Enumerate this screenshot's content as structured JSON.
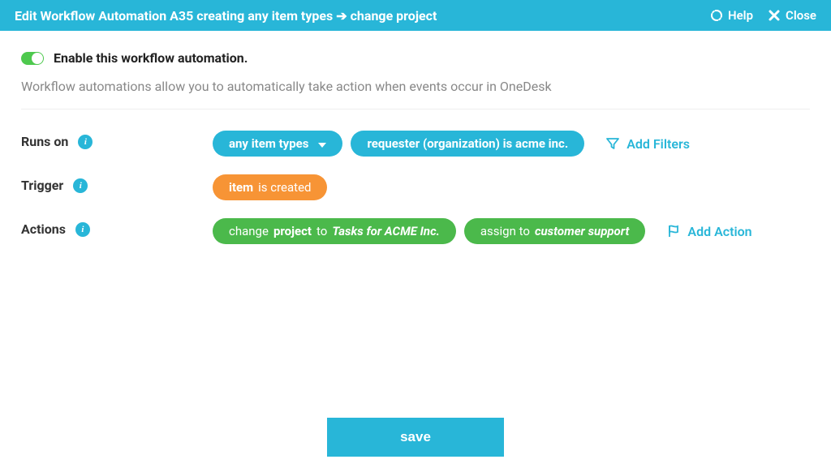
{
  "header": {
    "title": "Edit Workflow Automation A35 creating any item types ➔ change project",
    "help_label": "Help",
    "close_label": "Close"
  },
  "enable": {
    "label": "Enable this workflow automation."
  },
  "description": "Workflow automations allow you to automatically take action when events occur in OneDesk",
  "runs_on": {
    "label": "Runs on",
    "type_pill": "any item types",
    "filter_pill": "requester (organization) is acme inc.",
    "add_filters": "Add Filters"
  },
  "trigger": {
    "label": "Trigger",
    "subject": "item",
    "verb": "is created"
  },
  "actions": {
    "label": "Actions",
    "action1": {
      "verb": "change",
      "field": "project",
      "to": "to",
      "value": "Tasks for ACME Inc."
    },
    "action2": {
      "verb": "assign to",
      "value": "customer support"
    },
    "add_action": "Add Action"
  },
  "footer": {
    "save": "save"
  }
}
